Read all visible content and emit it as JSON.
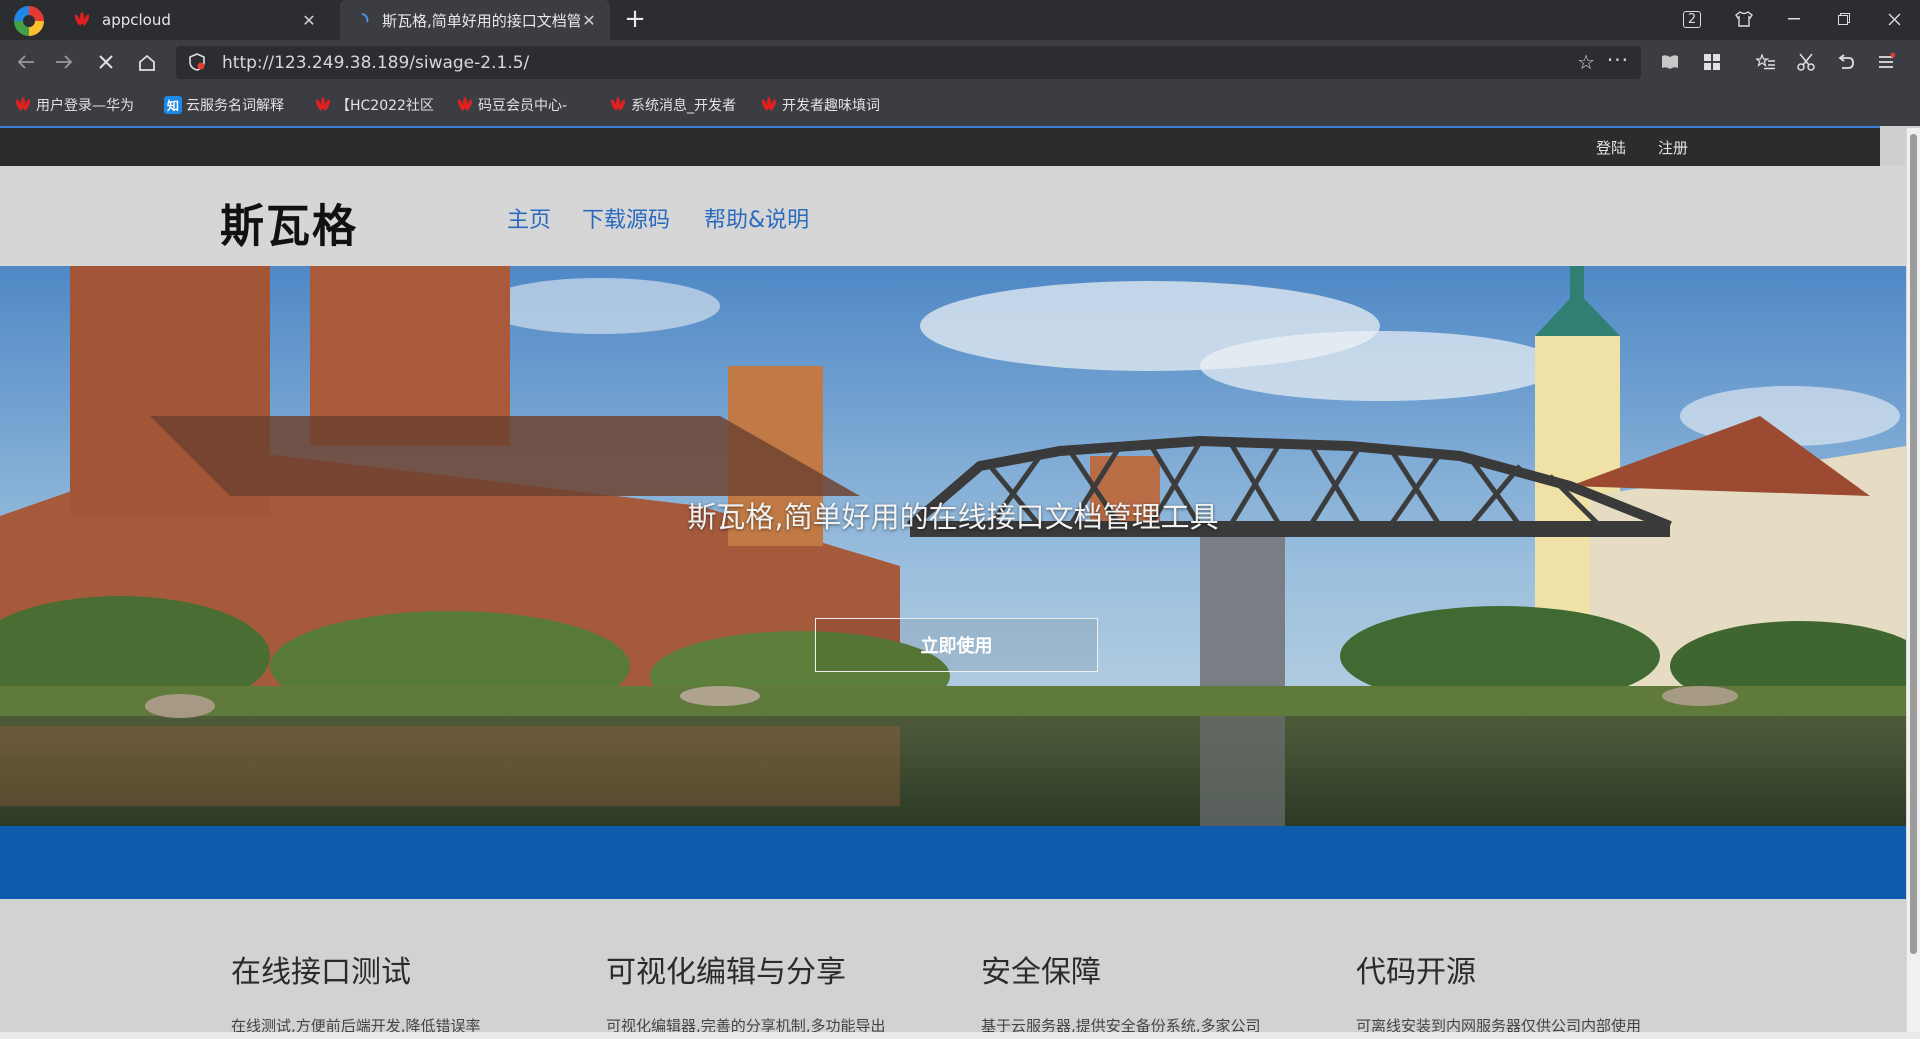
{
  "browser": {
    "tabs": [
      {
        "title": "appcloud",
        "active": false
      },
      {
        "title": "斯瓦格,简单好用的接口文档管",
        "active": true
      }
    ],
    "tab_close": "✕",
    "new_tab": "+",
    "tab_count": "2",
    "url": "http://123.249.38.189/siwage-2.1.5/",
    "url_more": "···",
    "bookmarks": [
      {
        "label": "用户登录—华为",
        "icon": "huawei-icon"
      },
      {
        "label": "云服务名词解释",
        "icon": "zhihu-icon",
        "icon_text": "知"
      },
      {
        "label": "【HC2022社区",
        "icon": "huawei-icon"
      },
      {
        "label": "码豆会员中心-",
        "icon": "huawei-icon"
      },
      {
        "label": "系统消息_开发者",
        "icon": "huawei-icon"
      },
      {
        "label": "开发者趣味填词",
        "icon": "huawei-icon"
      }
    ],
    "accent_color": "#3d7fd8"
  },
  "site": {
    "topbar": {
      "login": "登陆",
      "register": "注册"
    },
    "logo": "斯瓦格",
    "nav": [
      "主页",
      "下载源码",
      "帮助&说明"
    ],
    "nav_color": "#2a6bbf",
    "hero": {
      "title": "斯瓦格,简单好用的在线接口文档管理工具",
      "button": "立即使用"
    },
    "band_color": "#0f5bae",
    "features": [
      {
        "title": "在线接口测试",
        "desc": "在线测试,方便前后端开发,降低错误率"
      },
      {
        "title": "可视化编辑与分享",
        "desc": "可视化编辑器,完善的分享机制,多功能导出"
      },
      {
        "title": "安全保障",
        "desc": "基于云服务器,提供安全备份系统,多家公司"
      },
      {
        "title": "代码开源",
        "desc": "可离线安装到内网服务器仅供公司内部使用"
      }
    ]
  }
}
